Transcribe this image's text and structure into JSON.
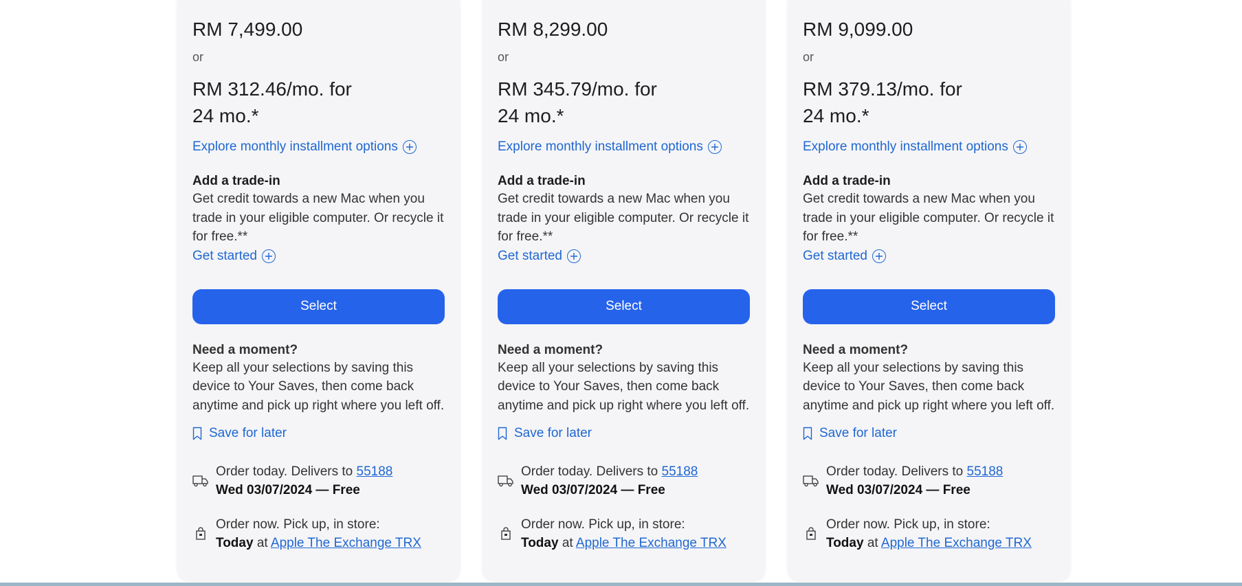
{
  "cards": [
    {
      "price": "RM 7,499.00",
      "or": "or",
      "monthly": "RM 312.46/mo. for 24 mo.*",
      "explore_label": "Explore monthly installment options",
      "trade_heading": "Add a trade-in",
      "trade_text": "Get credit towards a new Mac when you trade in your eligible computer. Or recycle it for free.**",
      "get_started": "Get started",
      "select_label": "Select",
      "moment_heading": "Need a moment?",
      "moment_text": "Keep all your selections by saving this device to Your Saves, then come back anytime and pick up right where you left off.",
      "save_label": "Save for later",
      "delivery_prefix": "Order today. Delivers to ",
      "delivery_zip": "55188",
      "delivery_date": "Wed 03/07/2024 — Free",
      "pickup_prefix": "Order now. Pick up, in store:",
      "pickup_today": "Today",
      "pickup_at": " at ",
      "pickup_store": "Apple The Exchange TRX"
    },
    {
      "price": "RM 8,299.00",
      "or": "or",
      "monthly": "RM 345.79/mo. for 24 mo.*",
      "explore_label": "Explore monthly installment options",
      "trade_heading": "Add a trade-in",
      "trade_text": "Get credit towards a new Mac when you trade in your eligible computer. Or recycle it for free.**",
      "get_started": "Get started",
      "select_label": "Select",
      "moment_heading": "Need a moment?",
      "moment_text": "Keep all your selections by saving this device to Your Saves, then come back anytime and pick up right where you left off.",
      "save_label": "Save for later",
      "delivery_prefix": "Order today. Delivers to ",
      "delivery_zip": "55188",
      "delivery_date": "Wed 03/07/2024 — Free",
      "pickup_prefix": "Order now. Pick up, in store:",
      "pickup_today": "Today",
      "pickup_at": " at ",
      "pickup_store": "Apple The Exchange TRX"
    },
    {
      "price": "RM 9,099.00",
      "or": "or",
      "monthly": "RM 379.13/mo. for 24 mo.*",
      "explore_label": "Explore monthly installment options",
      "trade_heading": "Add a trade-in",
      "trade_text": "Get credit towards a new Mac when you trade in your eligible computer. Or recycle it for free.**",
      "get_started": "Get started",
      "select_label": "Select",
      "moment_heading": "Need a moment?",
      "moment_text": "Keep all your selections by saving this device to Your Saves, then come back anytime and pick up right where you left off.",
      "save_label": "Save for later",
      "delivery_prefix": "Order today. Delivers to ",
      "delivery_zip": "55188",
      "delivery_date": "Wed 03/07/2024 — Free",
      "pickup_prefix": "Order now. Pick up, in store:",
      "pickup_today": "Today",
      "pickup_at": " at ",
      "pickup_store": "Apple The Exchange TRX"
    }
  ],
  "colors": {
    "accent": "#2663eb",
    "link": "#1f67d2",
    "card_bg": "#f5f5f7"
  }
}
